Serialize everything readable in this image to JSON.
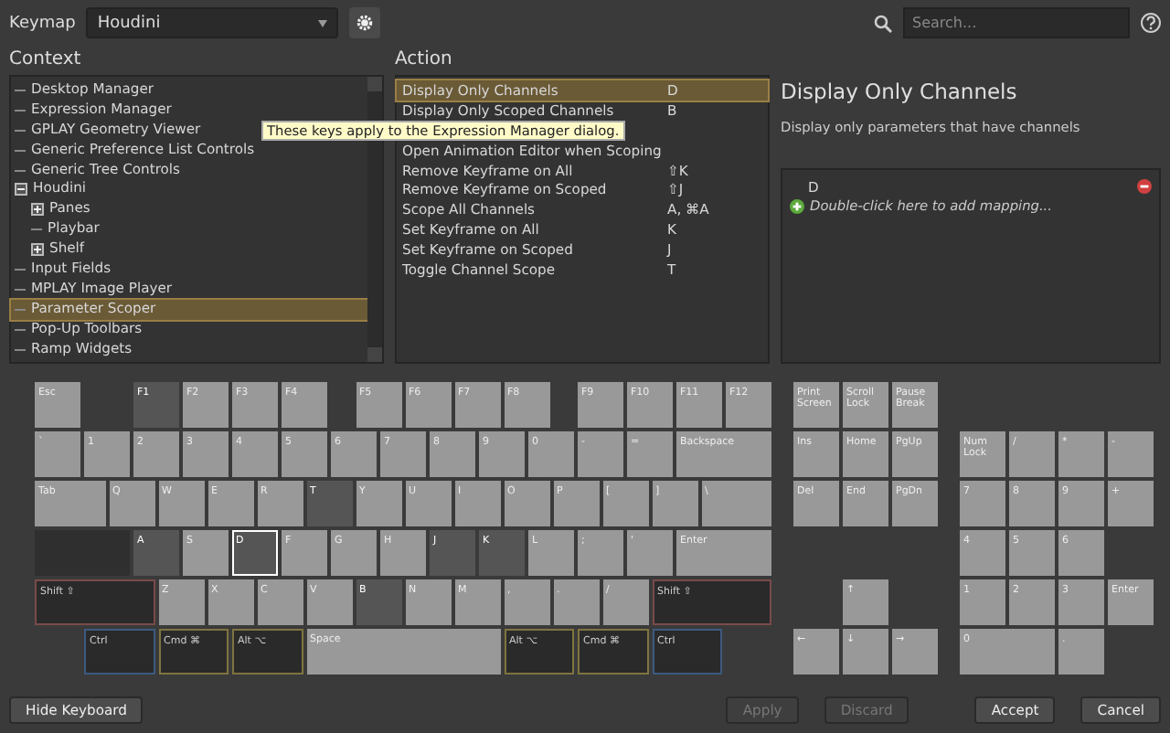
{
  "toolbar": {
    "keymap_label": "Keymap",
    "keymap_value": "Houdini",
    "search_placeholder": "Search..."
  },
  "context": {
    "title": "Context",
    "items": [
      {
        "label": "Desktop Manager",
        "selected": false
      },
      {
        "label": "Expression Manager",
        "selected": false
      },
      {
        "label": "GPLAY Geometry Viewer",
        "selected": false
      },
      {
        "label": "Generic Preference List Controls",
        "selected": false
      },
      {
        "label": "Generic Tree Controls",
        "selected": false
      },
      {
        "label": "Houdini",
        "selected": false,
        "expanded": true,
        "children": [
          {
            "label": "Panes",
            "selected": false,
            "expanded": false
          },
          {
            "label": "Playbar",
            "selected": false
          },
          {
            "label": "Shelf",
            "selected": false,
            "expanded": false
          }
        ]
      },
      {
        "label": "Input Fields",
        "selected": false
      },
      {
        "label": "MPLAY Image Player",
        "selected": false
      },
      {
        "label": "Parameter Scoper",
        "selected": true
      },
      {
        "label": "Pop-Up Toolbars",
        "selected": false
      },
      {
        "label": "Ramp Widgets",
        "selected": false
      }
    ]
  },
  "tooltip": "These keys apply to the Expression Manager dialog.",
  "action": {
    "title": "Action",
    "rows": [
      {
        "action": "Display Only Channels",
        "key": "D",
        "selected": true
      },
      {
        "action": "Display Only Scoped Channels",
        "key": "B",
        "selected": false
      },
      {
        "action": "Open Animation Editor when Scoping",
        "key": "",
        "selected": false
      },
      {
        "action": "Remove Keyframe on All",
        "key": "⇧K",
        "selected": false
      },
      {
        "action": "Remove Keyframe on Scoped",
        "key": "⇧J",
        "selected": false
      },
      {
        "action": "Scope All Channels",
        "key": "A, ⌘A",
        "selected": false
      },
      {
        "action": "Set Keyframe on All",
        "key": "K",
        "selected": false
      },
      {
        "action": "Set Keyframe on Scoped",
        "key": "J",
        "selected": false
      },
      {
        "action": "Toggle Channel Scope",
        "key": "T",
        "selected": false
      }
    ]
  },
  "detail": {
    "title": "Display Only Channels",
    "description": "Display only parameters that have channels",
    "mappings": [
      "D"
    ],
    "add_hint": "Double-click here to add mapping..."
  },
  "keyboard": {
    "main": [
      [
        {
          "label": "Esc",
          "kind": "key"
        },
        {
          "label": "F1",
          "kind": "bound"
        },
        {
          "label": "F2",
          "kind": "key"
        },
        {
          "label": "F3",
          "kind": "key"
        },
        {
          "label": "F4",
          "kind": "key"
        },
        {
          "label": "F5",
          "kind": "key"
        },
        {
          "label": "F6",
          "kind": "key"
        },
        {
          "label": "F7",
          "kind": "key"
        },
        {
          "label": "F8",
          "kind": "key"
        },
        {
          "label": "F9",
          "kind": "key"
        },
        {
          "label": "F10",
          "kind": "key"
        },
        {
          "label": "F11",
          "kind": "key"
        },
        {
          "label": "F12",
          "kind": "key"
        }
      ],
      [
        {
          "label": "`",
          "kind": "key"
        },
        {
          "label": "1",
          "kind": "key"
        },
        {
          "label": "2",
          "kind": "key"
        },
        {
          "label": "3",
          "kind": "key"
        },
        {
          "label": "4",
          "kind": "key"
        },
        {
          "label": "5",
          "kind": "key"
        },
        {
          "label": "6",
          "kind": "key"
        },
        {
          "label": "7",
          "kind": "key"
        },
        {
          "label": "8",
          "kind": "key"
        },
        {
          "label": "9",
          "kind": "key"
        },
        {
          "label": "0",
          "kind": "key"
        },
        {
          "label": "-",
          "kind": "key"
        },
        {
          "label": "=",
          "kind": "key"
        },
        {
          "label": "Backspace",
          "kind": "key"
        }
      ],
      [
        {
          "label": "Tab",
          "kind": "key"
        },
        {
          "label": "Q",
          "kind": "key"
        },
        {
          "label": "W",
          "kind": "key"
        },
        {
          "label": "E",
          "kind": "key"
        },
        {
          "label": "R",
          "kind": "key"
        },
        {
          "label": "T",
          "kind": "bound"
        },
        {
          "label": "Y",
          "kind": "key"
        },
        {
          "label": "U",
          "kind": "key"
        },
        {
          "label": "I",
          "kind": "key"
        },
        {
          "label": "O",
          "kind": "key"
        },
        {
          "label": "P",
          "kind": "key"
        },
        {
          "label": "[",
          "kind": "key"
        },
        {
          "label": "]",
          "kind": "key"
        },
        {
          "label": "\\",
          "kind": "key"
        }
      ],
      [
        {
          "kind": "disabled"
        },
        {
          "label": "A",
          "kind": "bound"
        },
        {
          "label": "S",
          "kind": "key"
        },
        {
          "label": "D",
          "kind": "current"
        },
        {
          "label": "F",
          "kind": "key"
        },
        {
          "label": "G",
          "kind": "key"
        },
        {
          "label": "H",
          "kind": "key"
        },
        {
          "label": "J",
          "kind": "bound"
        },
        {
          "label": "K",
          "kind": "bound"
        },
        {
          "label": "L",
          "kind": "key"
        },
        {
          "label": ";",
          "kind": "key"
        },
        {
          "label": "'",
          "kind": "key"
        },
        {
          "label": "Enter",
          "kind": "key"
        }
      ],
      [
        {
          "label": "Shift ⇧",
          "kind": "shift"
        },
        {
          "label": "Z",
          "kind": "key"
        },
        {
          "label": "X",
          "kind": "key"
        },
        {
          "label": "C",
          "kind": "key"
        },
        {
          "label": "V",
          "kind": "key"
        },
        {
          "label": "B",
          "kind": "bound"
        },
        {
          "label": "N",
          "kind": "key"
        },
        {
          "label": "M",
          "kind": "key"
        },
        {
          "label": ",",
          "kind": "key"
        },
        {
          "label": ".",
          "kind": "key"
        },
        {
          "label": "/",
          "kind": "key"
        },
        {
          "label": "Shift ⇧",
          "kind": "shift"
        }
      ],
      [
        {
          "label": "Ctrl",
          "kind": "ctrl"
        },
        {
          "label": "Cmd ⌘",
          "kind": "cmd"
        },
        {
          "label": "Alt ⌥",
          "kind": "cmd"
        },
        {
          "label": "Space",
          "kind": "key"
        },
        {
          "label": "Alt ⌥",
          "kind": "cmd"
        },
        {
          "label": "Cmd ⌘",
          "kind": "cmd"
        },
        {
          "label": "Ctrl",
          "kind": "ctrl"
        }
      ]
    ],
    "nav": [
      {
        "label": "Print Screen",
        "kind": "key"
      },
      {
        "label": "Scroll Lock",
        "kind": "key"
      },
      {
        "label": "Pause Break",
        "kind": "key"
      },
      {
        "label": "Ins",
        "kind": "key"
      },
      {
        "label": "Home",
        "kind": "key"
      },
      {
        "label": "PgUp",
        "kind": "key"
      },
      {
        "label": "Del",
        "kind": "key"
      },
      {
        "label": "End",
        "kind": "key"
      },
      {
        "label": "PgDn",
        "kind": "key"
      },
      {
        "label": "↑",
        "kind": "key"
      },
      {
        "label": "←",
        "kind": "key"
      },
      {
        "label": "↓",
        "kind": "key"
      },
      {
        "label": "→",
        "kind": "key"
      }
    ],
    "numpad": [
      {
        "label": "Num Lock",
        "kind": "key"
      },
      {
        "label": "/",
        "kind": "key"
      },
      {
        "label": "*",
        "kind": "key"
      },
      {
        "label": "-",
        "kind": "key"
      },
      {
        "label": "7",
        "kind": "key"
      },
      {
        "label": "8",
        "kind": "key"
      },
      {
        "label": "9",
        "kind": "key"
      },
      {
        "label": "+",
        "kind": "key"
      },
      {
        "label": "4",
        "kind": "key"
      },
      {
        "label": "5",
        "kind": "key"
      },
      {
        "label": "6",
        "kind": "key"
      },
      {
        "label": "1",
        "kind": "key"
      },
      {
        "label": "2",
        "kind": "key"
      },
      {
        "label": "3",
        "kind": "key"
      },
      {
        "label": "Enter",
        "kind": "key"
      },
      {
        "label": "0",
        "kind": "key"
      },
      {
        "label": ".",
        "kind": "key"
      }
    ]
  },
  "buttons": [
    {
      "label": "Hide Keyboard",
      "disabled": false
    },
    {
      "label": "Apply",
      "disabled": true
    },
    {
      "label": "Discard",
      "disabled": true
    },
    {
      "label": "Accept",
      "disabled": false
    },
    {
      "label": "Cancel",
      "disabled": false
    }
  ]
}
